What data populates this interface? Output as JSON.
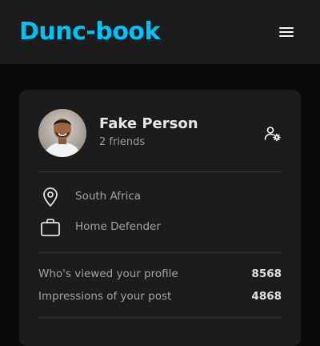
{
  "header": {
    "brand": "Dunc-book",
    "menu_icon": "hamburger-menu-icon",
    "brand_color": "#00c2f5"
  },
  "profile": {
    "name": "Fake Person",
    "friends": "2 friends",
    "manage_icon": "user-settings-icon"
  },
  "details": {
    "location": {
      "icon": "location-pin-icon",
      "text": "South Africa"
    },
    "occupation": {
      "icon": "briefcase-icon",
      "text": "Home Defender"
    }
  },
  "stats": [
    {
      "label": "Who's viewed your profile",
      "value": "8568"
    },
    {
      "label": "Impressions of your post",
      "value": "4868"
    }
  ]
}
